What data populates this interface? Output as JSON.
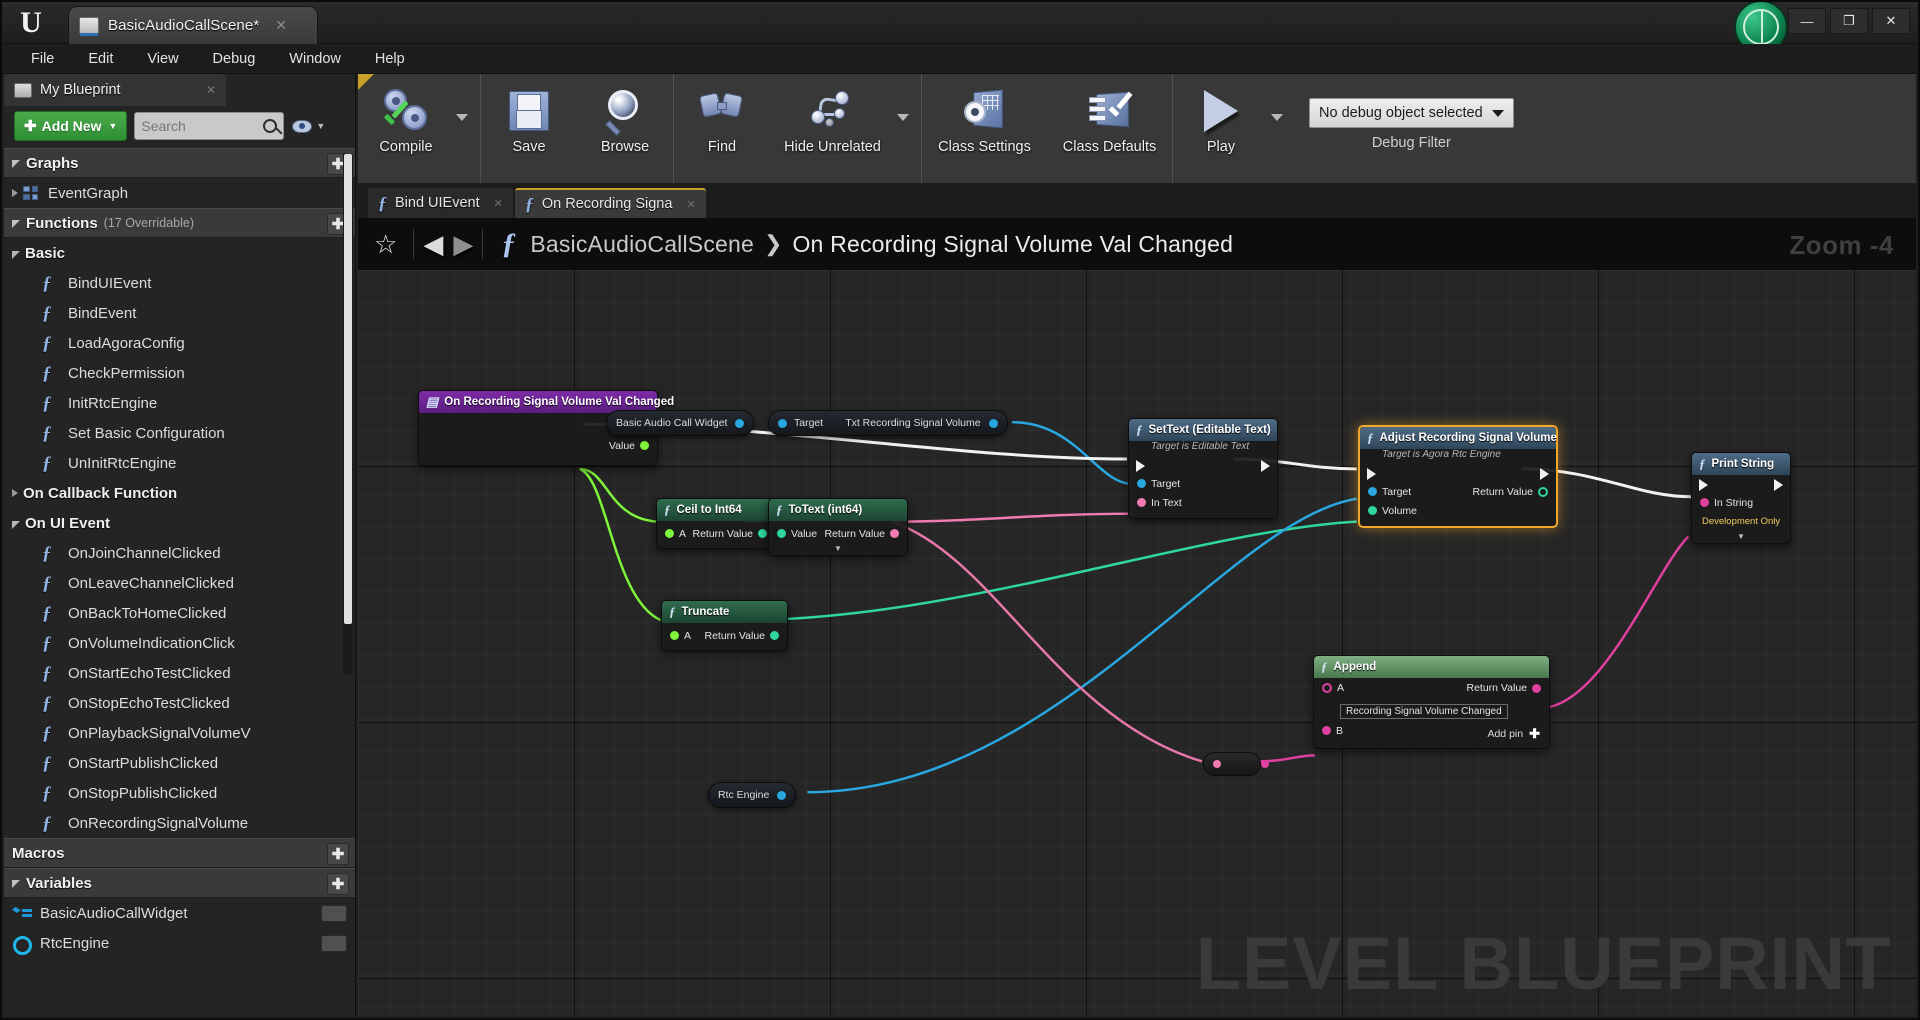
{
  "titlebar": {
    "logo": "ue-logo",
    "tab_title": "BasicAudioCallScene*",
    "tab_close": "✕",
    "minimize": "—",
    "maximize": "❐",
    "close": "✕"
  },
  "menubar": {
    "items": [
      "File",
      "Edit",
      "View",
      "Debug",
      "Window",
      "Help"
    ]
  },
  "myblueprint": {
    "tab_label": "My Blueprint",
    "tab_close": "✕",
    "add_new_label": "Add New",
    "add_new_plus": "✚",
    "search_placeholder": "Search",
    "search_value": "",
    "sections": [
      {
        "title": "Graphs",
        "sub": "",
        "add": "✚",
        "expanded": true,
        "items": [
          {
            "label": "EventGraph",
            "icon": "graph-icon",
            "collapsed": true
          }
        ]
      },
      {
        "title": "Functions",
        "sub": "(17 Overridable)",
        "add": "✚",
        "expanded": true,
        "groups": [
          {
            "label": "Basic",
            "expanded": true,
            "items": [
              "BindUIEvent",
              "BindEvent",
              "LoadAgoraConfig",
              "CheckPermission",
              "InitRtcEngine",
              "Set Basic Configuration",
              "UnInitRtcEngine"
            ]
          },
          {
            "label": "On Callback Function",
            "expanded": false,
            "items": []
          },
          {
            "label": "On UI Event",
            "expanded": true,
            "items": [
              "OnJoinChannelClicked",
              "OnLeaveChannelClicked",
              "OnBackToHomeClicked",
              "OnVolumeIndicationClick",
              "OnStartEchoTestClicked",
              "OnStopEchoTestClicked",
              "OnPlaybackSignalVolumeV",
              "OnStartPublishClicked",
              "OnStopPublishClicked",
              "OnRecordingSignalVolume"
            ]
          }
        ]
      },
      {
        "title": "Macros",
        "sub": "",
        "add": "✚",
        "expanded": false,
        "items": []
      },
      {
        "title": "Variables",
        "sub": "",
        "add": "✚",
        "expanded": true,
        "items": [
          {
            "label": "BasicAudioCallWidget",
            "icon": "widget-var-icon"
          },
          {
            "label": "RtcEngine",
            "icon": "object-var-icon"
          }
        ]
      }
    ]
  },
  "toolbar": {
    "compile": "Compile",
    "save": "Save",
    "browse": "Browse",
    "find": "Find",
    "hide_unrelated": "Hide Unrelated",
    "class_settings": "Class Settings",
    "class_defaults": "Class Defaults",
    "play": "Play",
    "debug_object": "No debug object selected",
    "debug_filter_label": "Debug Filter"
  },
  "graph_tabs": [
    {
      "label": "Bind UIEvent",
      "active": false,
      "close": "✕"
    },
    {
      "label": "On Recording Signa",
      "active": true,
      "close": "✕"
    }
  ],
  "breadcrumb": {
    "star": "☆",
    "back": "◀",
    "forward": "▶",
    "fn_icon": "function-icon",
    "root": "BasicAudioCallScene",
    "chevron": "❯",
    "current": "On Recording Signal Volume Val Changed",
    "zoom": "Zoom -4"
  },
  "canvas": {
    "watermark": "LEVEL BLUEPRINT"
  },
  "graph": {
    "nodes": [
      {
        "id": "event",
        "type": "event",
        "title": "On Recording Signal Volume Val Changed",
        "sub": "",
        "out_exec": true,
        "out_pins": [
          {
            "label": "Value",
            "color": "#7ef53a"
          }
        ]
      },
      {
        "id": "var_widget",
        "type": "variable",
        "title": "Basic Audio Call Widget"
      },
      {
        "id": "txt_getter",
        "type": "variable_get",
        "in_label": "Target",
        "out_label": "Txt Recording Signal Volume"
      },
      {
        "id": "settext",
        "type": "function",
        "title": "SetText (Editable Text)",
        "sub": "Target is Editable Text",
        "in_pins": [
          {
            "label": "Target",
            "color": "#29a7e0"
          },
          {
            "label": "In Text",
            "color": "#f07bb0"
          }
        ]
      },
      {
        "id": "adjust",
        "type": "function",
        "selected": true,
        "title": "Adjust Recording Signal Volume",
        "sub": "Target is Agora Rtc Engine",
        "in_pins": [
          {
            "label": "Target",
            "color": "#29a7e0"
          },
          {
            "label": "Volume",
            "color": "#2fd6a0"
          }
        ],
        "out_pins": [
          {
            "label": "Return Value",
            "color": "#2fd6a0",
            "ring": true
          }
        ]
      },
      {
        "id": "ceil",
        "type": "pure",
        "title": "Ceil to Int64",
        "in_pins": [
          {
            "label": "A",
            "color": "#7ef53a"
          }
        ],
        "out_pins": [
          {
            "label": "Return Value",
            "color": "#2fd6a0"
          }
        ]
      },
      {
        "id": "totext",
        "type": "pure",
        "title": "ToText (int64)",
        "in_pins": [
          {
            "label": "Value",
            "color": "#2fd6a0"
          }
        ],
        "out_pins": [
          {
            "label": "Return Value",
            "color": "#f07bb0"
          }
        ]
      },
      {
        "id": "truncate",
        "type": "pure",
        "title": "Truncate",
        "in_pins": [
          {
            "label": "A",
            "color": "#7ef53a"
          }
        ],
        "out_pins": [
          {
            "label": "Return Value",
            "color": "#2fd6a0"
          }
        ]
      },
      {
        "id": "append",
        "type": "append",
        "title": "Append",
        "in_pins": [
          {
            "label": "A",
            "color": "#e040a0",
            "ring": true,
            "value": "Recording Signal Volume Changed"
          },
          {
            "label": "B",
            "color": "#e040a0"
          }
        ],
        "out_pins": [
          {
            "label": "Return Value",
            "color": "#e040a0"
          }
        ],
        "add_pin": "Add pin",
        "add_pin_glyph": "✚"
      },
      {
        "id": "print",
        "type": "function",
        "title": "Print String",
        "in_pins": [
          {
            "label": "In String",
            "color": "#e040a0"
          }
        ],
        "extra_label": "Development Only"
      },
      {
        "id": "rtc_engine",
        "type": "variable",
        "title": "Rtc Engine"
      },
      {
        "id": "tostring_mini",
        "type": "mini"
      }
    ]
  }
}
